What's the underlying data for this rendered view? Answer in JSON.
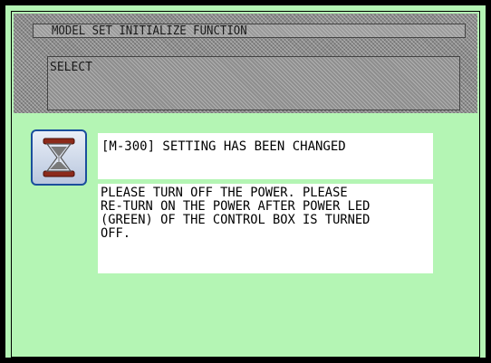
{
  "window": {
    "title": "MODEL SET INITIALIZE FUNCTION"
  },
  "select_panel": {
    "label": "SELECT"
  },
  "icon": {
    "name": "hourglass-icon",
    "frame_color": "#1a4f9c",
    "cap_color": "#8c2a1a",
    "sand_color": "#7a7a7a"
  },
  "message": {
    "title": "[M-300] SETTING HAS BEEN CHANGED",
    "body_lines": [
      "PLEASE TURN OFF THE POWER. PLEASE",
      "RE-TURN ON THE POWER AFTER POWER LED",
      "(GREEN) OF THE CONTROL BOX IS TURNED",
      "OFF."
    ]
  },
  "colors": {
    "background": "#b4f5b4",
    "frame": "#000000",
    "panel": "#ffffff"
  }
}
